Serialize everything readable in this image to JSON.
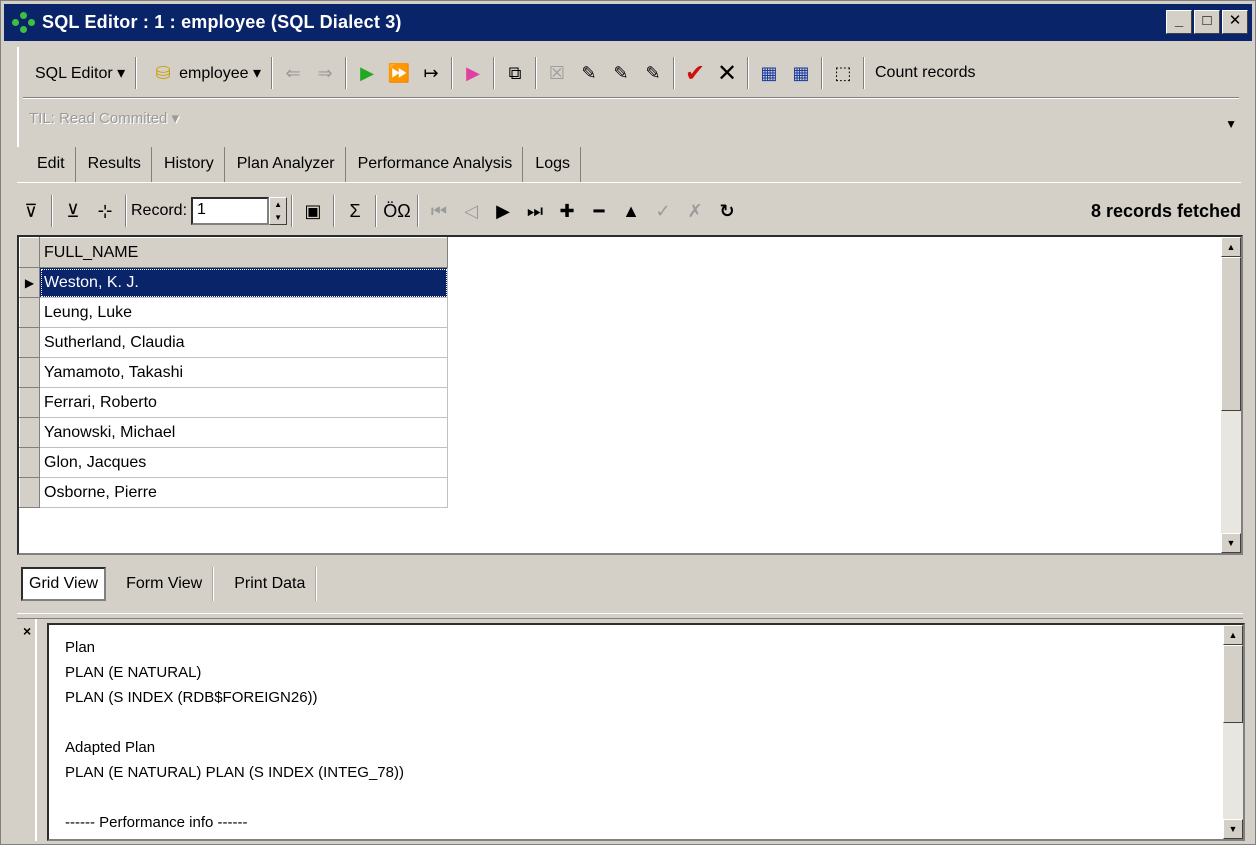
{
  "window": {
    "title": "SQL Editor : 1 : employee (SQL Dialect 3)",
    "min": "_",
    "max": "□",
    "close": "✕"
  },
  "toolbar": {
    "sql_editor_menu": "SQL Editor ▾",
    "database_menu": "employee ▾",
    "count_records": "Count records",
    "til_menu": "TIL: Read Commited ▾"
  },
  "tabs": [
    "Edit",
    "Results",
    "History",
    "Plan Analyzer",
    "Performance Analysis",
    "Logs"
  ],
  "active_tab": "Results",
  "navigator": {
    "record_label": "Record:",
    "record_value": "1",
    "sigma": "Σ",
    "oq": "ÖΩ",
    "fetched": "8 records fetched"
  },
  "grid": {
    "column": "FULL_NAME",
    "rows": [
      "Weston, K. J.",
      "Leung, Luke",
      "Sutherland, Claudia",
      "Yamamoto, Takashi",
      "Ferrari, Roberto",
      "Yanowski, Michael",
      "Glon, Jacques",
      "Osborne, Pierre"
    ],
    "selected_row": 0
  },
  "view_tabs": [
    "Grid View",
    "Form View",
    "Print Data"
  ],
  "active_view": "Grid View",
  "plan": {
    "lines": [
      "Plan",
      "PLAN (E NATURAL)",
      "PLAN (S INDEX (RDB$FOREIGN26))",
      "",
      "Adapted Plan",
      "PLAN (E NATURAL) PLAN (S INDEX (INTEG_78))",
      "",
      "------ Performance info ------"
    ]
  },
  "colors": {
    "title_bar": "#0a246a",
    "selection": "#0a246a",
    "face": "#d4d0c8",
    "run_green": "#22a822",
    "commit_red": "#d01010",
    "debug_pink": "#e040a0"
  }
}
